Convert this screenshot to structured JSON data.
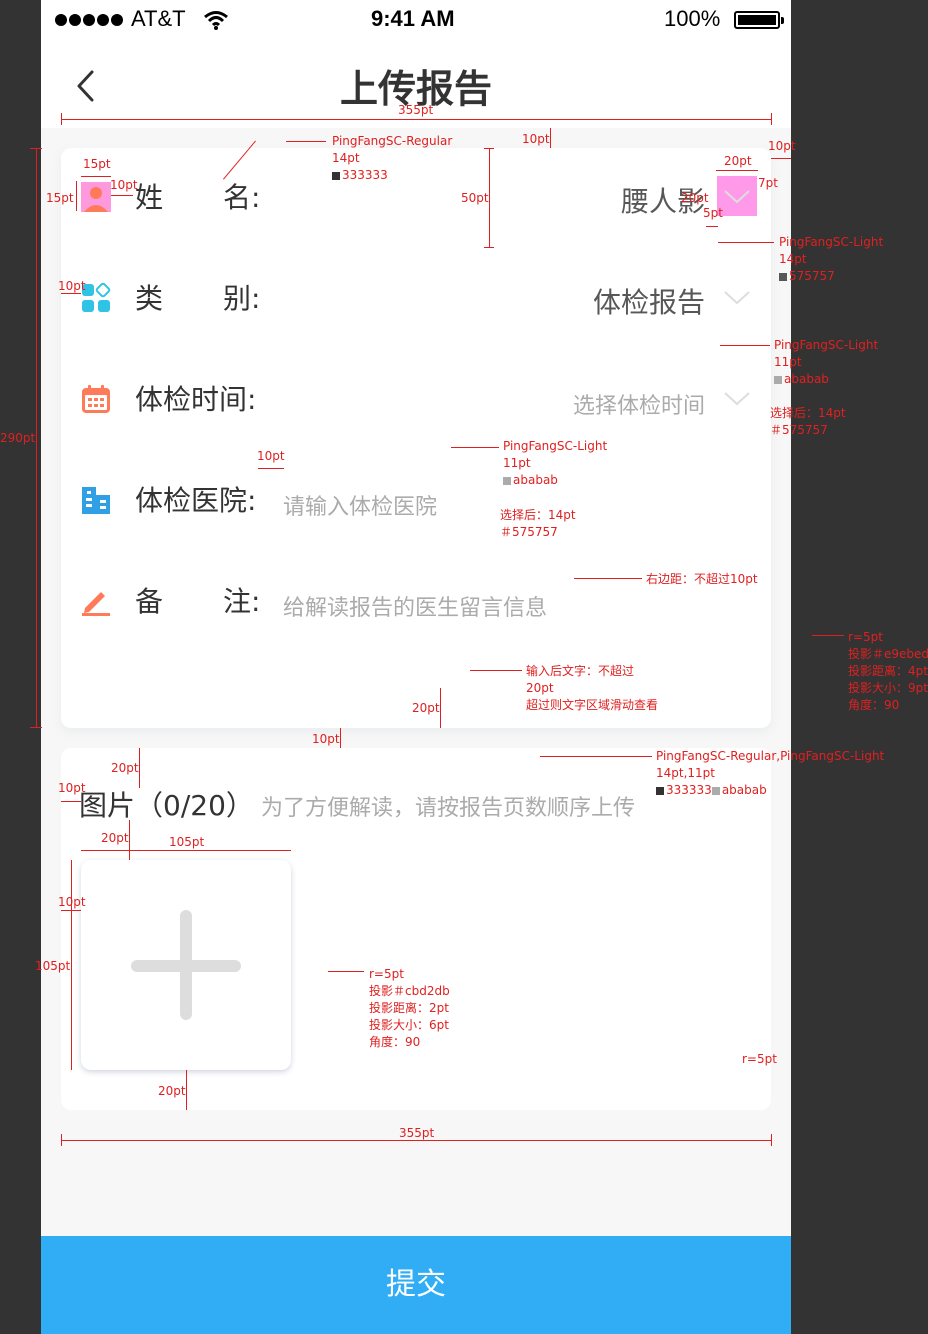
{
  "status_bar": {
    "carrier": "AT&T",
    "time": "9:41 AM",
    "battery": "100%"
  },
  "nav": {
    "title": "上传报告"
  },
  "form": {
    "name": {
      "label_left": "姓",
      "label_right": "名:",
      "value": "腰人影"
    },
    "category": {
      "label_left": "类",
      "label_right": "别:",
      "value": "体检报告"
    },
    "exam_time": {
      "label": "体检时间:",
      "placeholder": "选择体检时间"
    },
    "hospital": {
      "label": "体检医院:",
      "placeholder": "请输入体检医院"
    },
    "remark": {
      "label_left": "备",
      "label_right": "注:",
      "placeholder": "给解读报告的医生留言信息"
    }
  },
  "images": {
    "title": "图片（0/20）",
    "hint": "为了方便解读，请按报告页数顺序上传"
  },
  "submit_label": "提交",
  "annotations": {
    "w355_top": "355pt",
    "n10_top": "10pt",
    "n10_right": "10pt",
    "font_regular_label": "PingFangSC-Regular",
    "font_regular_size": "14pt",
    "font_regular_color": "333333",
    "n15_w": "15pt",
    "n15_h": "15pt",
    "n10_icon": "10pt",
    "n50": "50pt",
    "n20_chev": "20pt",
    "n7": "7pt",
    "n20_right": "20pt",
    "n5": "5pt",
    "font_light_1": "PingFangSC-Light",
    "font_light_1_size": "14pt",
    "font_light_1_color": "575757",
    "n10_left": "10pt",
    "font_light_2": "PingFangSC-Light",
    "font_light_2_size": "11pt",
    "font_light_2_color": "ababab",
    "after_select_1": "选择后：14pt",
    "after_select_1_color": "＃575757",
    "n290": "290pt",
    "n10_hospital": "10pt",
    "font_light_3": "PingFangSC-Light",
    "font_light_3_size": "11pt",
    "font_light_3_color": "ababab",
    "after_select_2": "选择后：14pt",
    "after_select_2_color": "＃575757",
    "right_margin": "右边距：不超过10pt",
    "card_r": "r=5pt",
    "card_shadow": "投影＃e9ebed",
    "card_shadow_dist": "投影距离：4pt",
    "card_shadow_size": "投影大小：9pt",
    "card_angle": "角度：90",
    "input_after_1": "输入后文字：不超过",
    "input_after_2": "20pt",
    "input_after_3": "超过则文字区域滑动查看",
    "n20_bottom": "20pt",
    "n10_gap": "10pt",
    "n20_img": "20pt",
    "n10_img_left": "10pt",
    "font_img": "PingFangSC-Regular,PingFangSC-Light",
    "font_img_size": "14pt,11pt",
    "font_img_color": "333333",
    "font_img_color2": "ababab",
    "n20_box": "20pt",
    "n105_w": "105pt",
    "n10_box_left": "10pt",
    "n105_h": "105pt",
    "box_r": "r=5pt",
    "box_shadow": "投影＃cbd2db",
    "box_shadow_dist": "投影距离：2pt",
    "box_shadow_size": "投影大小：6pt",
    "box_angle": "角度：90",
    "n20_box_bottom": "20pt",
    "img_card_r": "r=5pt",
    "w355_bottom": "355pt"
  },
  "colors": {
    "accent": "#30adf5",
    "text": "#333333",
    "value": "#575757",
    "placeholder": "#ababab",
    "annotation": "#e02020"
  }
}
